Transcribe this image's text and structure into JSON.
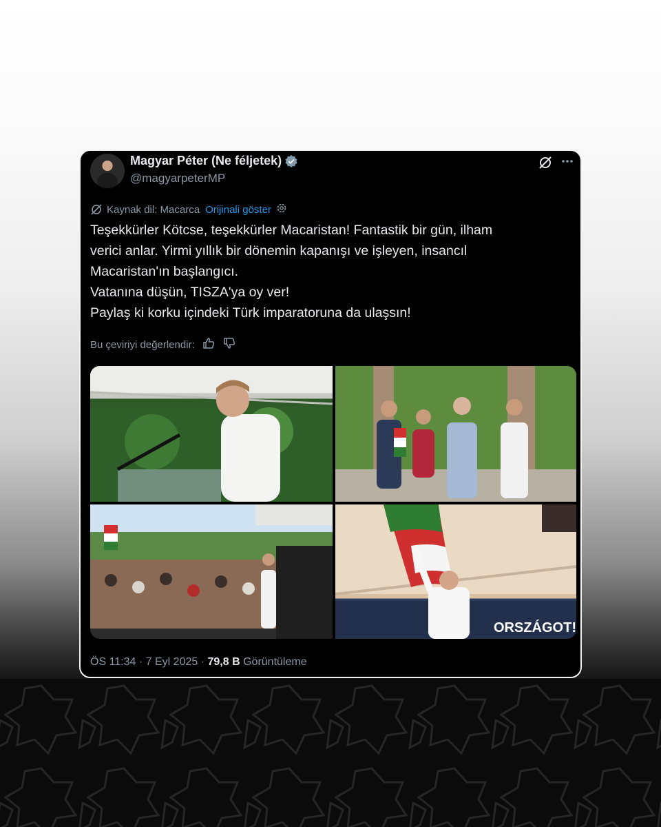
{
  "tweet": {
    "author_name": "Magyar Péter (Ne féljetek)",
    "handle": "@magyarpeterMP",
    "translation": {
      "source_label": "Kaynak dil: Macarca",
      "show_original": "Orijinali göster"
    },
    "text_lines": [
      "Teşekkürler Kötcse, teşekkürler Macaristan! Fantastik bir gün, ilham",
      "verici anlar. Yirmi yıllık bir dönemin kapanışı ve işleyen, insancıl",
      "Macaristan'ın başlangıcı.",
      "Vatanına düşün, TISZA'ya oy ver!",
      "Paylaş ki korku içindeki Türk imparatoruna da ulaşsın!"
    ],
    "rate_label": "Bu çeviriyi değerlendir:",
    "media_text": "ORSZÁGOT!",
    "time": "ÖS 11:34",
    "separator": "·",
    "date": "7 Eyl 2025",
    "views_count": "79,8 B",
    "views_label": "Görüntüleme"
  },
  "icons": {
    "verified": "verified-badge-icon",
    "grok": "grok-icon",
    "more": "more-icon",
    "translate": "translate-icon",
    "settings": "gear-icon",
    "thumbs_up": "thumbs-up-icon",
    "thumbs_down": "thumbs-down-icon"
  },
  "colors": {
    "link": "#1d9bf0",
    "secondary_text": "#8b98a5",
    "primary_text": "#e7e9ea",
    "card_bg": "#000000"
  }
}
